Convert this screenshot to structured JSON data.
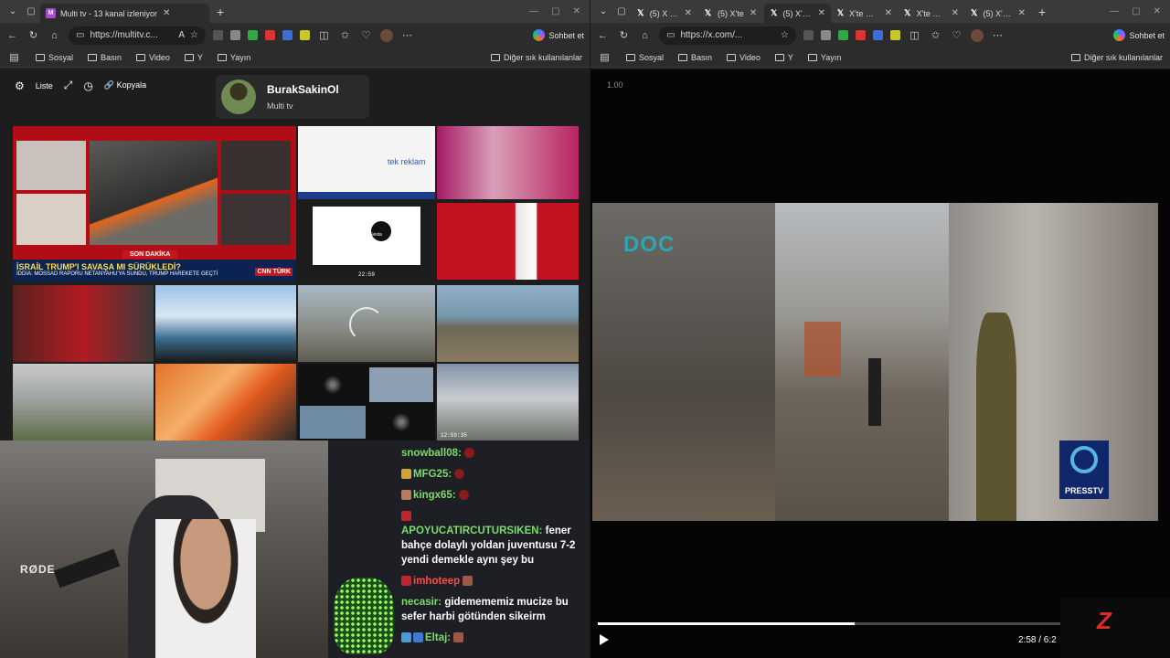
{
  "left_browser": {
    "tabs": [
      {
        "label": "Multi tv - 13 kanal izleniyor",
        "icon": "multitv-favicon",
        "active": true
      }
    ],
    "url": "https://multitv.c...",
    "copilot_label": "Sohbet et",
    "bookmarks": [
      "Sosyal",
      "Basın",
      "Video",
      "Y",
      "Yayın"
    ],
    "other_favorites": "Diğer sık kullanılanlar"
  },
  "right_browser": {
    "tabs": [
      {
        "label": "(5) X Pro",
        "icon": "x-favicon",
        "active": false
      },
      {
        "label": "(5) X'te",
        "icon": "x-favicon",
        "active": false
      },
      {
        "label": "(5) X'te P",
        "icon": "x-favicon",
        "active": true
      },
      {
        "label": "X'te Habe",
        "icon": "x-favicon",
        "active": false
      },
      {
        "label": "X'te Dark",
        "icon": "x-favicon",
        "active": false
      },
      {
        "label": "(5) X'te K",
        "icon": "x-favicon",
        "active": false
      }
    ],
    "url": "https://x.com/...",
    "copilot_label": "Sohbet et",
    "bookmarks": [
      "Sosyal",
      "Basın",
      "Video",
      "Y",
      "Yayın"
    ],
    "other_favorites": "Diğer sık kullanılanlar"
  },
  "multitv": {
    "controls": {
      "list": "Liste",
      "copy": "Kopyala"
    },
    "channel": {
      "name": "BurakSakinOl",
      "subtitle": "Multi tv"
    },
    "news": {
      "tag": "SON DAKİKA",
      "headline": "İSRAİL TRUMP'I SAVAŞA MI SÜRÜKLEDİ?",
      "subline": "İDDİA: MOSSAD RAPORU NETANYAHU'YA SUNDU, TRUMP HAREKETE GEÇTİ",
      "ticker": "13.59  HERBAHÇE BEKO, MACCABİ RAPYD'E 94-89 YENİLDİ • NBA'DE ROCKETS, ALPEREN ŞENGÜN'Ü",
      "network": "CNN TÜRK"
    },
    "ad_text": "tek reklam",
    "siesta": {
      "brand": "Siesta",
      "time": "22:59"
    },
    "cam_time": "12:59:35"
  },
  "chat": {
    "messages": [
      {
        "user": "snowball08:",
        "text": "",
        "user_color": "green"
      },
      {
        "user": "MFG25:",
        "text": "",
        "user_color": "green"
      },
      {
        "user": "kingx65:",
        "text": "",
        "user_color": "green"
      },
      {
        "user": "APOYUCATIRCUTURSIKEN:",
        "text": "fener bahçe dolaylı yoldan juventusu 7-2 yendi demekle aynı şey bu",
        "user_color": "green"
      },
      {
        "user": "imhoteep",
        "text": "",
        "user_color": "red"
      },
      {
        "user": "necasir:",
        "text": "gidemememiz mucize bu sefer harbi götünden sikeirm",
        "user_color": "green"
      },
      {
        "user": "Eltaj:",
        "text": "",
        "user_color": "green"
      }
    ]
  },
  "webcam": {
    "mic_brand": "RØDE"
  },
  "video": {
    "playback_speed": "1.00",
    "watermark": "DOC",
    "channel_logo": "PRESSTV",
    "time": "2:58 / 6:2",
    "progress": 0.54
  },
  "overlay_logo": "Z"
}
